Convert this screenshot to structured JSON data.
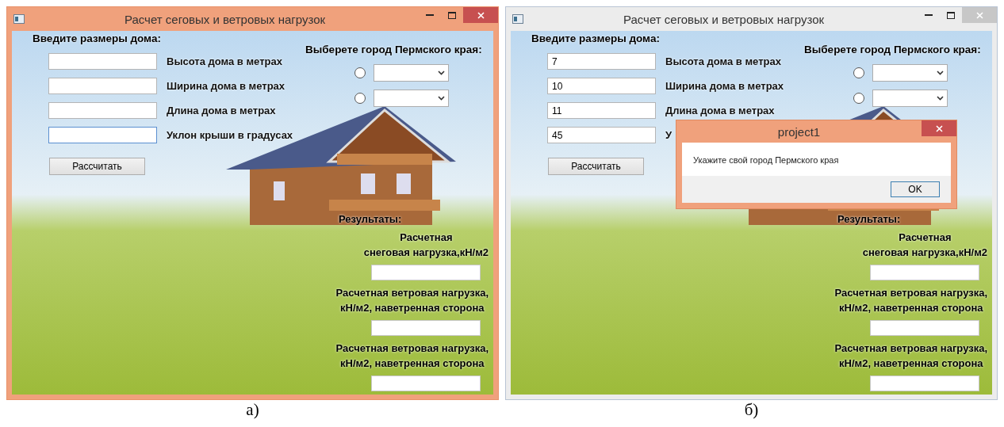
{
  "windows": [
    {
      "title": "Расчет сеговых и ветровых нагрузок",
      "active": true,
      "dimensions_heading": "Введите размеры дома:",
      "fields": [
        {
          "label": "Высота дома в метрах",
          "focused": false
        },
        {
          "label": "Ширина дома в метрах",
          "focused": false
        },
        {
          "label": "Длина дома в метрах",
          "focused": false
        },
        {
          "label": "Уклон крыши в градусах",
          "focused": true
        }
      ],
      "calculate_button": "Рассчитать",
      "city_heading": "Выберете город Пермского края:",
      "cities": [
        {
          "selected": false
        },
        {
          "selected": false
        }
      ],
      "results_heading": "Результаты:",
      "results": [
        {
          "label": "Расчетная\nснеговая нагрузка,кН/м2"
        },
        {
          "label": "Расчетная ветровая нагрузка,\nкН/м2, наветренная сторона"
        },
        {
          "label": "Расчетная ветровая нагрузка,\nкН/м2, наветренная сторона"
        }
      ],
      "caption": "а)"
    },
    {
      "title": "Расчет сеговых и ветровых нагрузок",
      "active": false,
      "dimensions_heading": "Введите размеры дома:",
      "fields": [
        {
          "label": "Высота дома в метрах",
          "value": "7",
          "focused": false
        },
        {
          "label": "Ширина дома в метрах",
          "value": "10",
          "focused": false
        },
        {
          "label": "Длина дома в метрах",
          "value": "11",
          "focused": false
        },
        {
          "label": "У",
          "value": "45",
          "focused": false
        }
      ],
      "calculate_button": "Рассчитать",
      "city_heading": "Выберете город Пермского края:",
      "cities": [
        {
          "selected": false
        },
        {
          "selected": false
        }
      ],
      "results_heading": "Результаты:",
      "results": [
        {
          "label": "Расчетная\nснеговая нагрузка,кН/м2"
        },
        {
          "label": "Расчетная ветровая нагрузка,\nкН/м2, наветренная сторона"
        },
        {
          "label": "Расчетная ветровая нагрузка,\nкН/м2, наветренная сторона"
        }
      ],
      "dialog": {
        "title": "project1",
        "message": "Укажите свой город Пермского края",
        "button": "OK"
      },
      "caption": "б)"
    }
  ]
}
